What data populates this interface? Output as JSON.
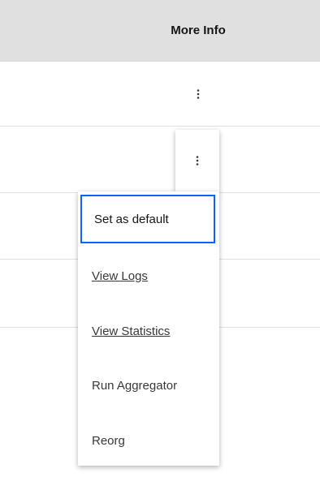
{
  "table": {
    "header": {
      "more_info_label": "More Info"
    },
    "rows": [
      {
        "overflow_icon": "overflow-menu-vertical-icon"
      },
      {
        "overflow_icon": "overflow-menu-vertical-icon",
        "menu_open": true
      },
      {},
      {}
    ]
  },
  "overflow_menu": {
    "items": [
      {
        "label": "Set as default",
        "focused": true
      },
      {
        "label": "View Logs",
        "underlined": true
      },
      {
        "label": "View Statistics",
        "underlined": true
      },
      {
        "label": "Run Aggregator"
      },
      {
        "label": "Reorg"
      }
    ]
  },
  "colors": {
    "header_background": "#e0e0e0",
    "row_divider": "#e0e0e0",
    "text_primary": "#161616",
    "text_secondary": "#393939",
    "focus_border": "#0f62fe",
    "surface": "#ffffff"
  }
}
